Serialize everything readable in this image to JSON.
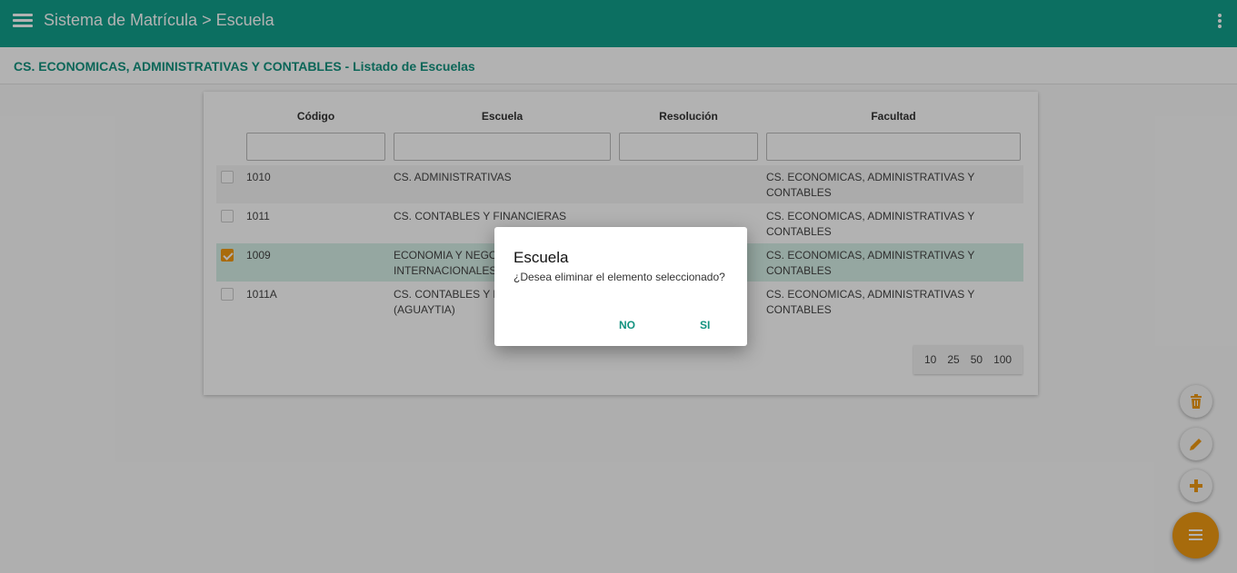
{
  "app": {
    "title": "Sistema de Matrícula > Escuela",
    "menu_icon": "menu-icon",
    "more_icon": "more-vert-icon",
    "brand_color": "#12a08c",
    "accent_color": "#f29a12"
  },
  "subheader": {
    "title": "CS. ECONOMICAS, ADMINISTRATIVAS Y CONTABLES - Listado de Escuelas"
  },
  "table": {
    "columns": [
      "Código",
      "Escuela",
      "Resolución",
      "Facultad"
    ],
    "rows": [
      {
        "checked": false,
        "codigo": "1010",
        "escuela": "CS. ADMINISTRATIVAS",
        "resolucion": "",
        "facultad": "CS. ECONOMICAS, ADMINISTRATIVAS Y CONTABLES"
      },
      {
        "checked": false,
        "codigo": "1011",
        "escuela": "CS. CONTABLES Y FINANCIERAS",
        "resolucion": "",
        "facultad": "CS. ECONOMICAS, ADMINISTRATIVAS Y CONTABLES"
      },
      {
        "checked": true,
        "codigo": "1009",
        "escuela": "ECONOMIA Y NEGO INTERNACIONALES",
        "resolucion": "",
        "facultad": "CS. ECONOMICAS, ADMINISTRATIVAS Y CONTABLES"
      },
      {
        "checked": false,
        "codigo": "1011A",
        "escuela": "CS. CONTABLES Y F (AGUAYTIA)",
        "resolucion": "",
        "facultad": "CS. ECONOMICAS, ADMINISTRATIVAS Y CONTABLES"
      }
    ],
    "page_sizes": [
      "10",
      "25",
      "50",
      "100"
    ]
  },
  "dialog": {
    "title": "Escuela",
    "message": "¿Desea eliminar el elemento seleccionado?",
    "no_label": "NO",
    "yes_label": "SI"
  },
  "fab": {
    "delete_icon": "trash-icon",
    "edit_icon": "pencil-icon",
    "add_icon": "plus-icon",
    "main_icon": "menu-icon"
  }
}
